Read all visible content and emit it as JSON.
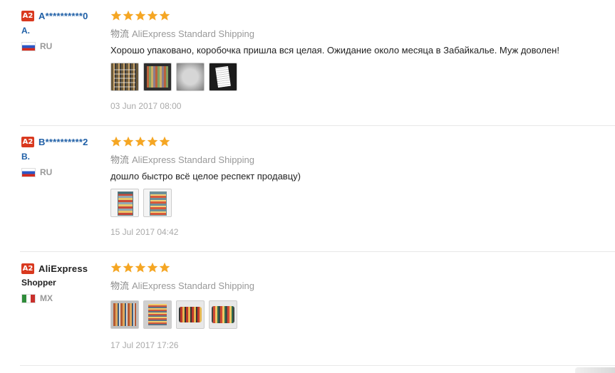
{
  "colors": {
    "badge": "#d9391f",
    "username": "#1f5fa6",
    "star": "#f5a623"
  },
  "reviews": [
    {
      "badge": "A2",
      "username": "A**********0",
      "initial": "A.",
      "country": "RU",
      "flag": "russia-flag",
      "stars": 5,
      "shipping_prefix": "物流",
      "shipping": "AliExpress Standard Shipping",
      "text": "Хорошо упаковано, коробочка пришла вся целая. Ожидание около месяца в Забайкалье. Муж доволен!",
      "photos": 4,
      "date": "03 Jun 2017 08:00"
    },
    {
      "badge": "A2",
      "username": "B**********2",
      "initial": "B.",
      "country": "RU",
      "flag": "russia-flag",
      "stars": 5,
      "shipping_prefix": "物流",
      "shipping": "AliExpress Standard Shipping",
      "text": "дошло быстро всё целое респект продавцу)",
      "photos": 2,
      "date": "15 Jul 2017 04:42"
    },
    {
      "badge": "A2",
      "username": "AliExpress",
      "initial": "Shopper",
      "country": "MX",
      "flag": "mexico-flag",
      "stars": 5,
      "shipping_prefix": "物流",
      "shipping": "AliExpress Standard Shipping",
      "text": "",
      "photos": 4,
      "date": "17 Jul 2017 17:26"
    }
  ]
}
